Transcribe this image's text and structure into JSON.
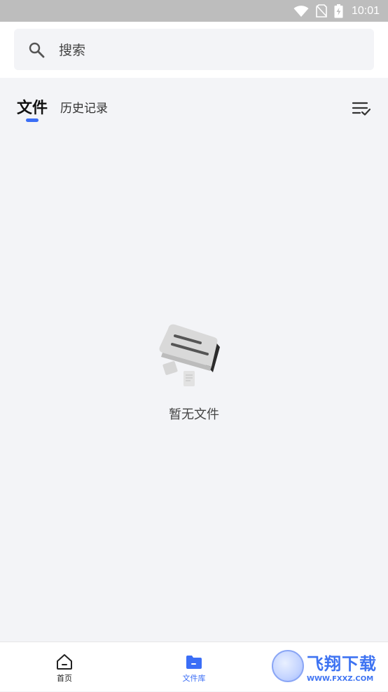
{
  "status_bar": {
    "time": "10:01",
    "icons": [
      "wifi-icon",
      "no-sim-icon",
      "battery-charging-icon"
    ]
  },
  "search": {
    "placeholder": "搜索",
    "icon": "search-icon"
  },
  "tabs": {
    "items": [
      {
        "label": "文件",
        "active": true
      },
      {
        "label": "历史记录",
        "active": false
      }
    ],
    "sort_icon": "sort-check-icon"
  },
  "empty_state": {
    "illustration": "empty-folder-illustration",
    "message": "暂无文件"
  },
  "bottom_nav": {
    "items": [
      {
        "label": "首页",
        "icon": "home-icon",
        "active": false
      },
      {
        "label": "文件库",
        "icon": "folder-icon",
        "active": true
      }
    ]
  },
  "watermark": {
    "name": "飞翔下载",
    "url": "WWW.FXXZ.COM"
  },
  "colors": {
    "accent": "#3b6ef6",
    "background": "#f3f4f7",
    "status_bar": "#bdbdbd"
  }
}
